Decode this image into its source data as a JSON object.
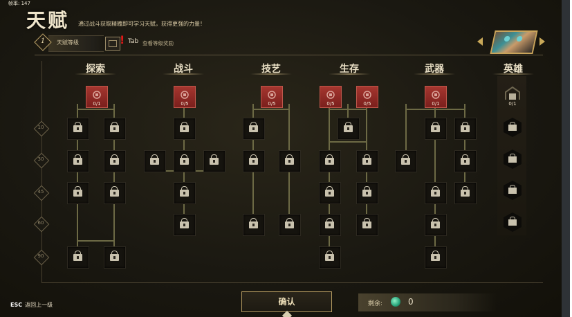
{
  "fps": "帧率: 147",
  "title": "天赋",
  "subtitle": "通过战斗获取精魄即可学习天赋，获得更强的力量！",
  "talent_level": {
    "value": "1",
    "label": "天赋等级"
  },
  "tab_hint": {
    "key": "Tab",
    "text": "查看等级奖励"
  },
  "categories": [
    "探索",
    "战斗",
    "技艺",
    "生存",
    "武器",
    "英雄"
  ],
  "level_markers": [
    "10",
    "30",
    "45",
    "60",
    "90"
  ],
  "root_nodes": [
    {
      "category": "探索",
      "count": "0/1",
      "icon": "gear-icon"
    },
    {
      "category": "战斗",
      "count": "0/5",
      "icon": "sword-icon"
    },
    {
      "category": "技艺",
      "count": "0/5",
      "icon": "flame-icon"
    },
    {
      "category": "生存",
      "count": "0/5",
      "icon": "cross-icon"
    },
    {
      "category": "生存",
      "count": "0/5",
      "icon": "shield-icon"
    },
    {
      "category": "武器",
      "count": "0/1",
      "icon": "star-icon"
    }
  ],
  "hero_count": "0/1",
  "esc": {
    "key": "ESC",
    "text": "返回上一级"
  },
  "confirm_label": "确认",
  "remaining": {
    "label": "剩余:",
    "value": "0"
  },
  "colors": {
    "accent": "#c9a959",
    "node_red": "#a5362f",
    "line": "#6d6a45"
  }
}
